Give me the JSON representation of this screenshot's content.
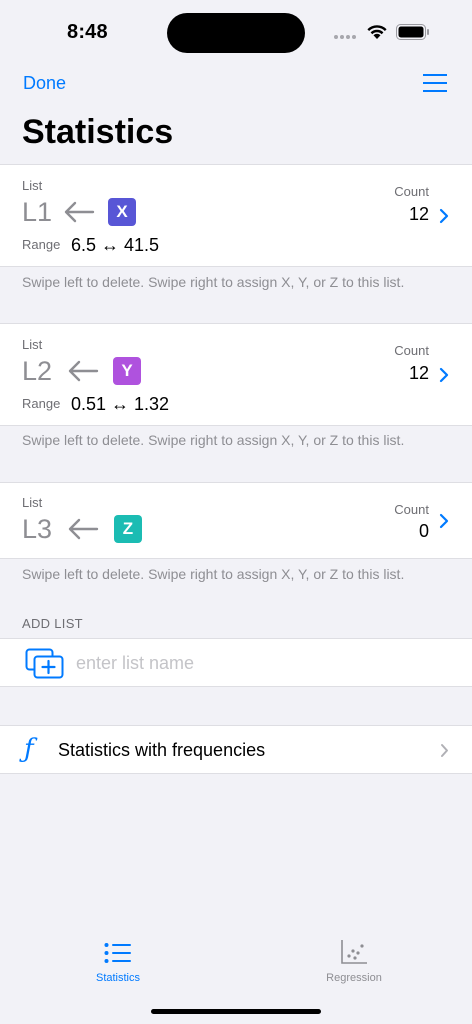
{
  "status": {
    "time": "8:48"
  },
  "nav": {
    "done_label": "Done",
    "title": "Statistics"
  },
  "lists": [
    {
      "caption": "List",
      "name": "L1",
      "badge": "X",
      "badge_color": "#5856d6",
      "range_label": "Range",
      "range_value": "6.5 ↔ 41.5",
      "count_label": "Count",
      "count": "12"
    },
    {
      "caption": "List",
      "name": "L2",
      "badge": "Y",
      "badge_color": "#af52de",
      "range_label": "Range",
      "range_value": "0.51 ↔ 1.32",
      "count_label": "Count",
      "count": "12"
    },
    {
      "caption": "List",
      "name": "L3",
      "badge": "Z",
      "badge_color": "#1bbcb3",
      "range_label": "",
      "range_value": "",
      "count_label": "Count",
      "count": "0"
    }
  ],
  "hint": "Swipe left to delete. Swipe right to assign X, Y, or Z to this list.",
  "add_list": {
    "section_label": "ADD LIST",
    "placeholder": "enter list name",
    "value": ""
  },
  "frequencies": {
    "label": "Statistics with frequencies"
  },
  "tabs": [
    {
      "label": "Statistics",
      "active": true
    },
    {
      "label": "Regression",
      "active": false
    }
  ],
  "colors": {
    "accent": "#007aff",
    "inactive": "#8e8e93"
  }
}
